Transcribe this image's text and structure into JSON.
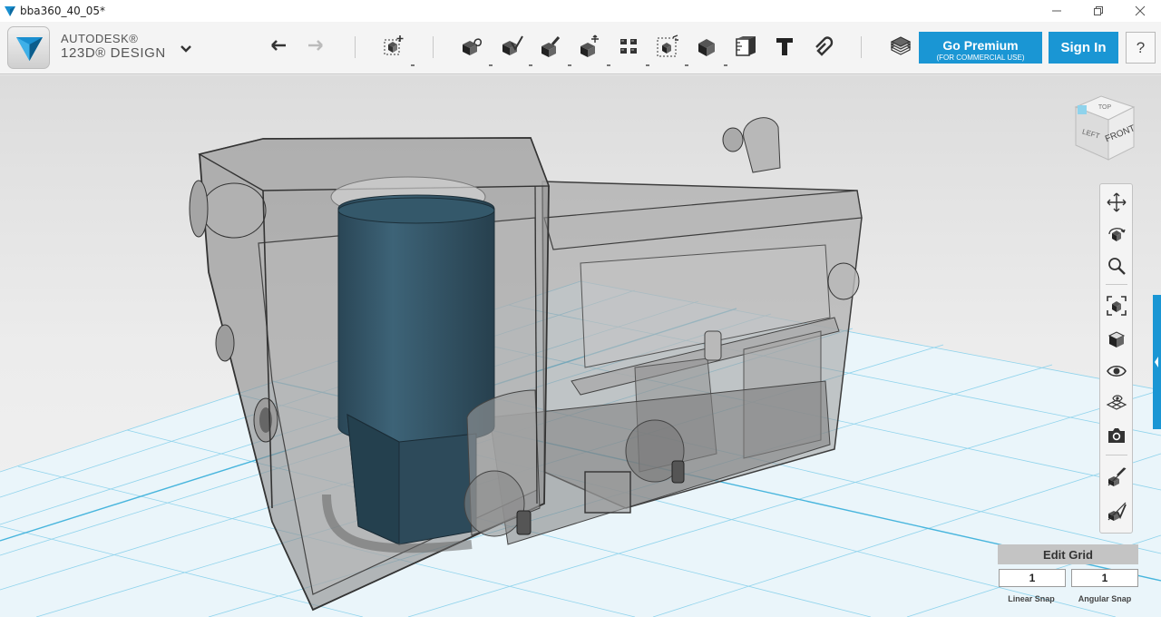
{
  "window": {
    "title": "bba360_40_05*"
  },
  "brand": {
    "line1": "AUTODESK®",
    "line2": "123D® DESIGN"
  },
  "toolbar": {
    "tools": [
      "undo-icon",
      "redo-icon",
      "primitives-icon",
      "sketch-icon",
      "construct-icon",
      "modify-icon",
      "pattern-icon",
      "grouping-icon",
      "combine-icon",
      "measure-icon",
      "text-icon",
      "snap-icon",
      "material-icon"
    ],
    "premium_label": "Go Premium",
    "premium_sub": "(FOR COMMERCIAL USE)",
    "signin_label": "Sign In",
    "help_label": "?"
  },
  "viewcube": {
    "top": "TOP",
    "left": "LEFT",
    "front": "FRONT"
  },
  "grid": {
    "edit_label": "Edit Grid",
    "linear_value": "1",
    "angular_value": "1",
    "linear_label": "Linear Snap",
    "angular_label": "Angular Snap"
  },
  "colors": {
    "accent": "#1a96d4",
    "grid_line": "#8fd3ec",
    "model_body": "#8a8a8a",
    "cylinder": "#2e4f61"
  }
}
